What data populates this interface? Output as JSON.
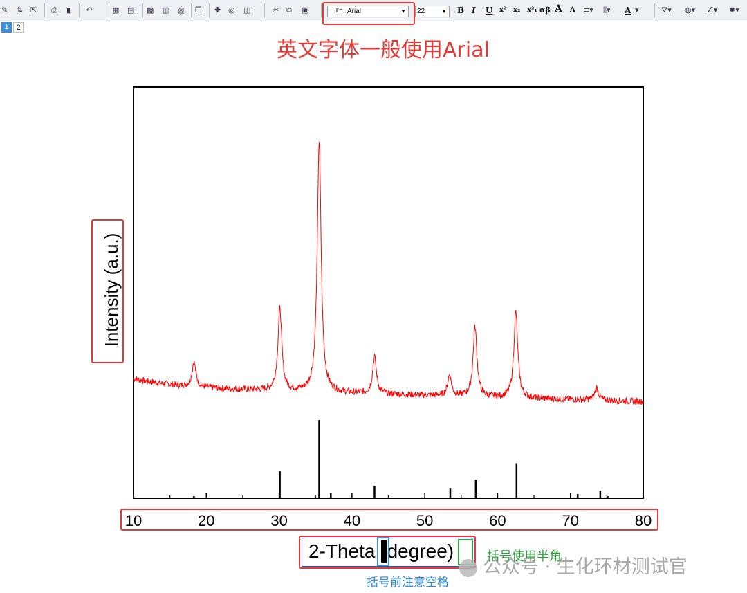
{
  "toolbar": {
    "font_name": "Arial",
    "font_size": "22",
    "bold": "B",
    "italic": "I",
    "underline": "U",
    "superscript": "x²",
    "subscript": "x₂",
    "supersub": "x²₁",
    "greek": "αβ",
    "grow_font": "A",
    "shrink_font": "A",
    "font_color": "A"
  },
  "pages": [
    "1",
    "2"
  ],
  "annotations": {
    "top": "英文字体一般使用Arial",
    "bracket_halfwidth": "括号使用半角",
    "space_before_bracket": "括号前注意空格"
  },
  "watermark": "公众号 · 生化环材测试官",
  "chart_data": {
    "type": "line",
    "xlabel": "2-Theta (degree)",
    "ylabel": "Intensity (a.u.)",
    "xlim": [
      10,
      80
    ],
    "xticks": [
      "10",
      "20",
      "30",
      "40",
      "50",
      "60",
      "70",
      "80"
    ],
    "series": [
      {
        "color": "#ff0000",
        "kind": "xrd-pattern",
        "peaks": [
          {
            "x": 18.3,
            "h": 0.06
          },
          {
            "x": 30.1,
            "h": 0.2
          },
          {
            "x": 35.5,
            "h": 0.61
          },
          {
            "x": 43.1,
            "h": 0.09
          },
          {
            "x": 53.4,
            "h": 0.05
          },
          {
            "x": 56.9,
            "h": 0.17
          },
          {
            "x": 62.5,
            "h": 0.21
          },
          {
            "x": 73.6,
            "h": 0.03
          }
        ]
      },
      {
        "color": "#000000",
        "kind": "reference-sticks",
        "sticks": [
          {
            "x": 18.3,
            "h": 0.005
          },
          {
            "x": 30.1,
            "h": 0.066
          },
          {
            "x": 35.5,
            "h": 0.19
          },
          {
            "x": 37.1,
            "h": 0.012
          },
          {
            "x": 43.1,
            "h": 0.03
          },
          {
            "x": 53.5,
            "h": 0.025
          },
          {
            "x": 57.0,
            "h": 0.045
          },
          {
            "x": 62.6,
            "h": 0.085
          },
          {
            "x": 71.0,
            "h": 0.01
          },
          {
            "x": 74.1,
            "h": 0.018
          },
          {
            "x": 75.1,
            "h": 0.005
          }
        ]
      }
    ]
  }
}
